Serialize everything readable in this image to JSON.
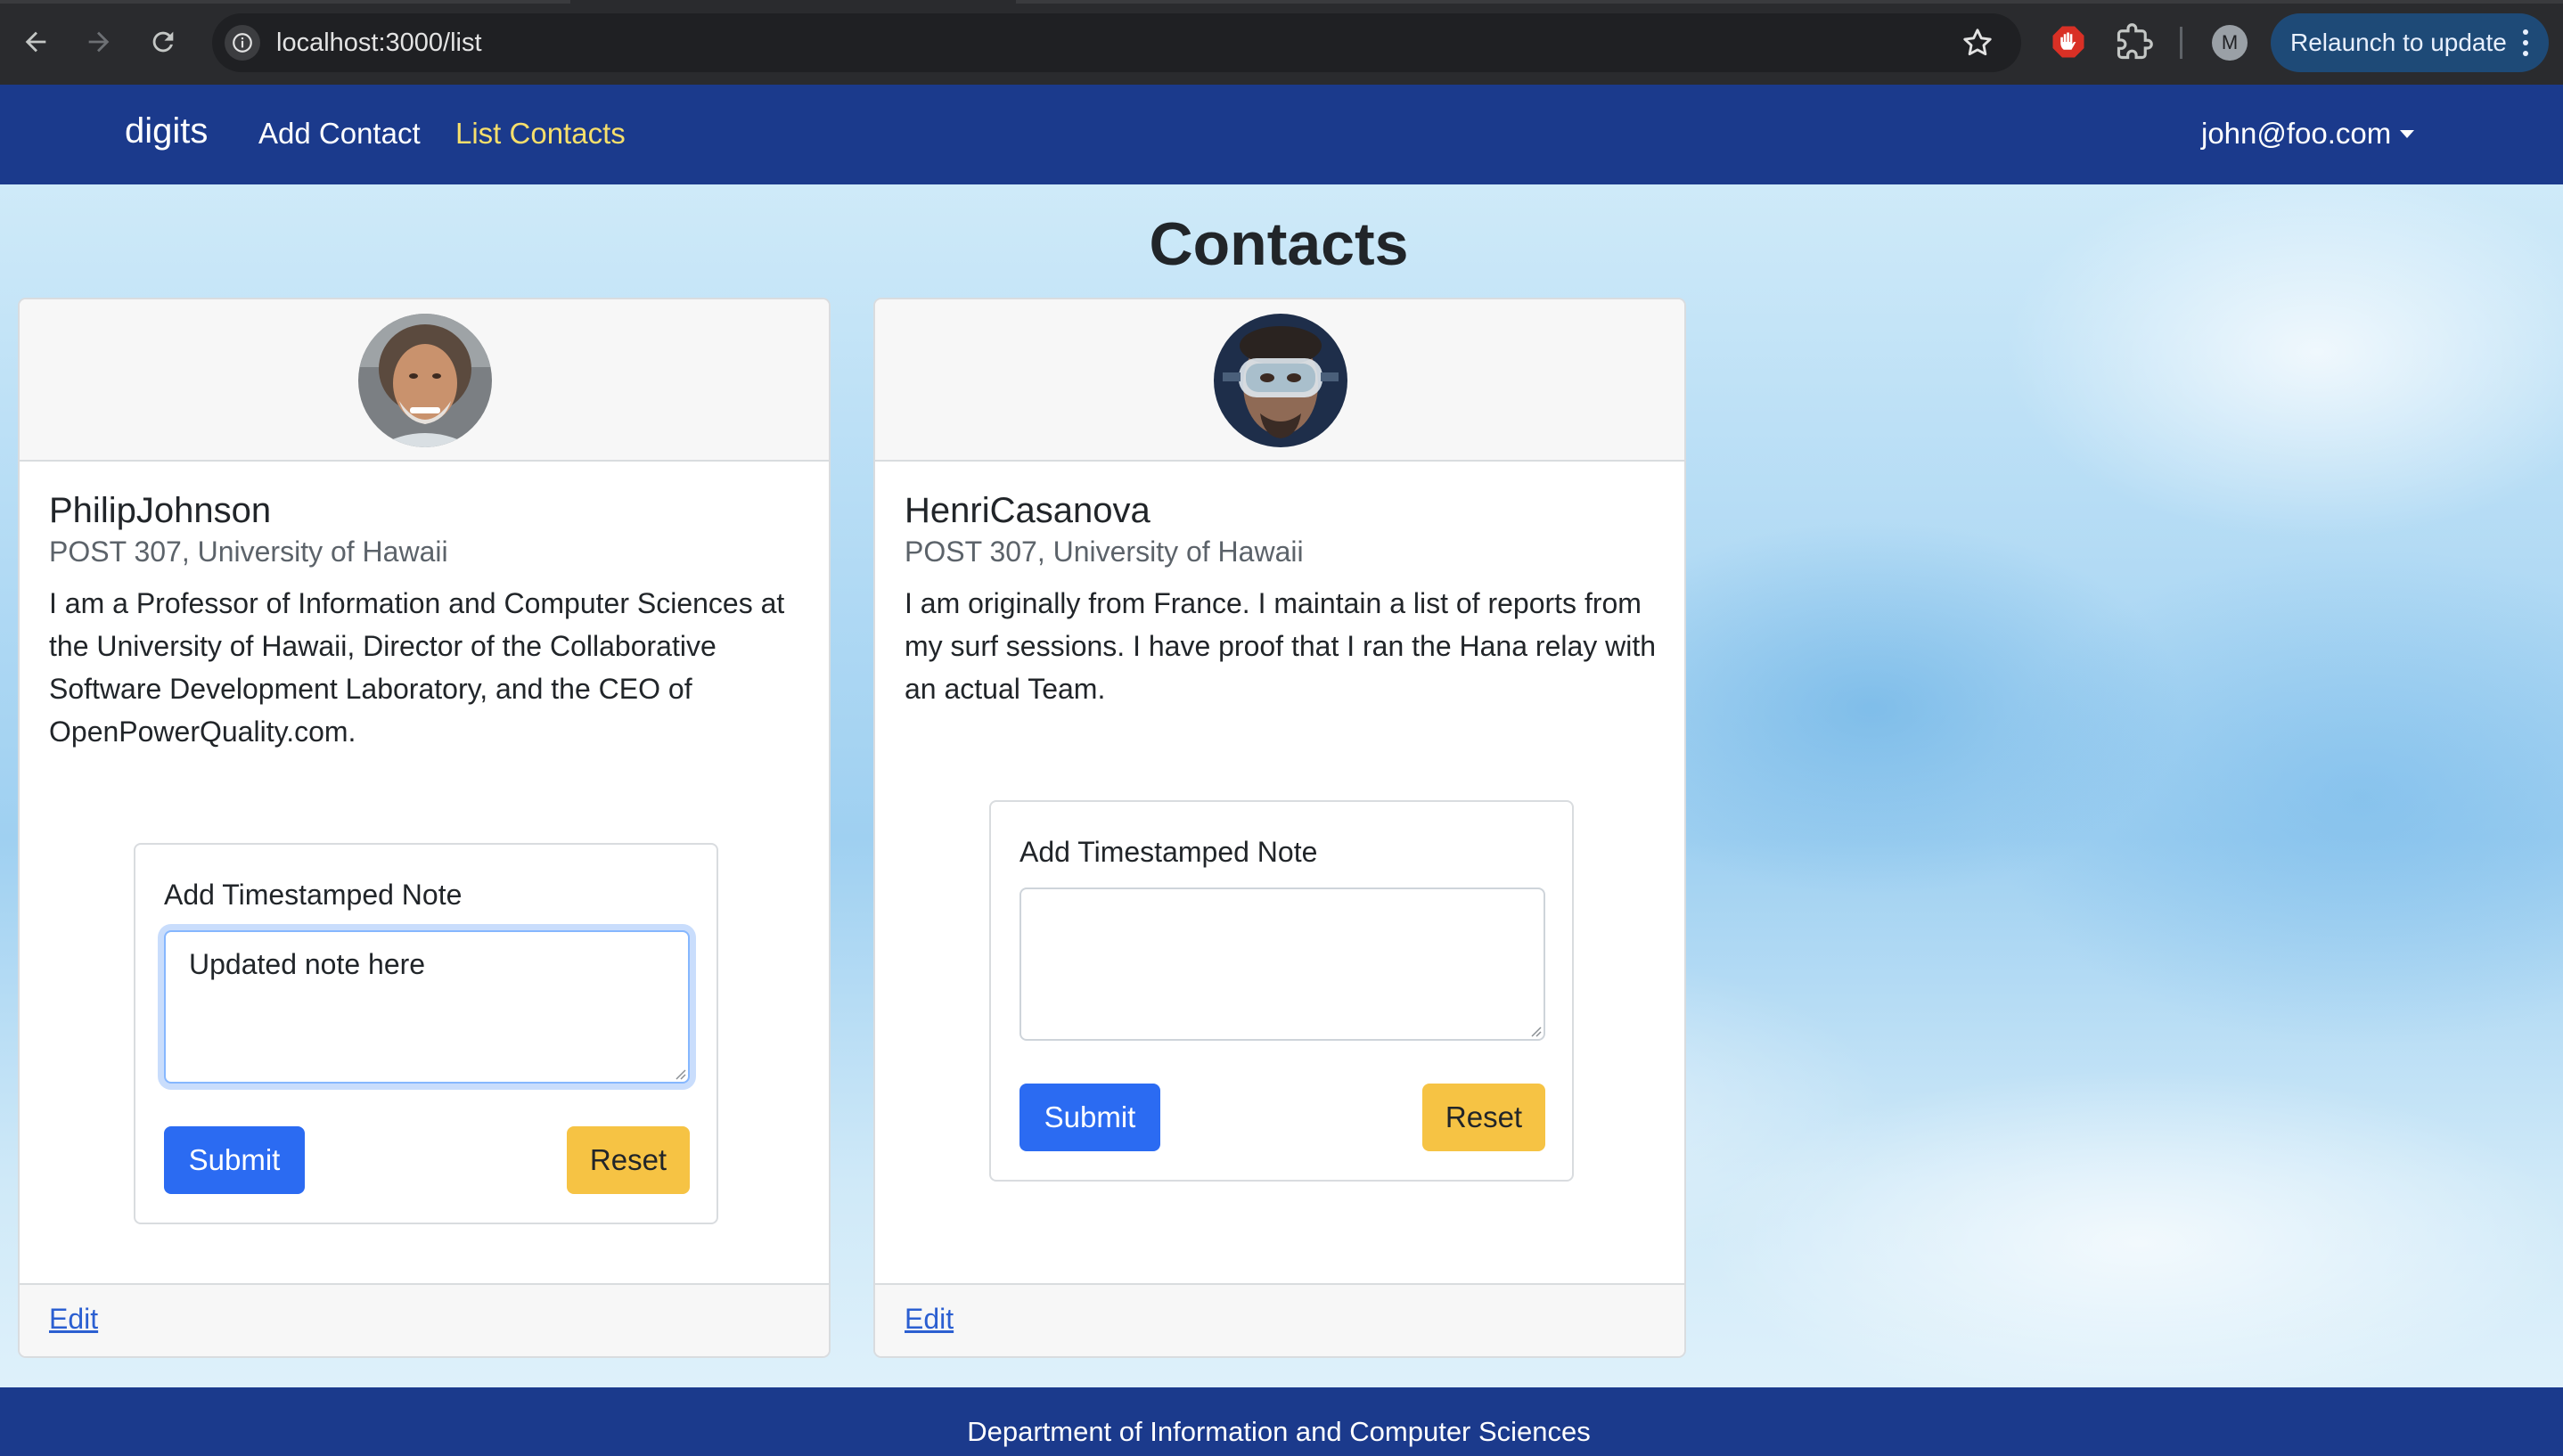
{
  "browser": {
    "url": "localhost:3000/list",
    "profile_initial": "M",
    "relaunch_label": "Relaunch to update"
  },
  "navbar": {
    "brand": "digits",
    "links": [
      {
        "label": "Add Contact"
      },
      {
        "label": "List Contacts",
        "active": true
      }
    ],
    "user": "john@foo.com",
    "active_link_color": "#f7df6b",
    "background": "#1b3a8c"
  },
  "page": {
    "title": "Contacts"
  },
  "contacts": [
    {
      "name": "PhilipJohnson",
      "address": "POST 307, University of Hawaii",
      "description": "I am a Professor of Information and Computer Sciences at the University of Hawaii, Director of the Collaborative Software Development Laboratory, and the CEO of OpenPowerQuality.com.",
      "note_label": "Add Timestamped Note",
      "note_value": "Updated note here",
      "note_focused": true,
      "submit_label": "Submit",
      "reset_label": "Reset",
      "edit_label": "Edit"
    },
    {
      "name": "HenriCasanova",
      "address": "POST 307, University of Hawaii",
      "description": "I am originally from France. I maintain a list of reports from my surf sessions. I have proof that I ran the Hana relay with an actual Team.",
      "note_label": "Add Timestamped Note",
      "note_value": "",
      "note_focused": false,
      "submit_label": "Submit",
      "reset_label": "Reset",
      "edit_label": "Edit"
    }
  ],
  "footer": {
    "text": "Department of Information and Computer Sciences"
  },
  "colors": {
    "submit": "#2b6bf2",
    "reset": "#f6c344",
    "link": "#2b5fd1"
  }
}
